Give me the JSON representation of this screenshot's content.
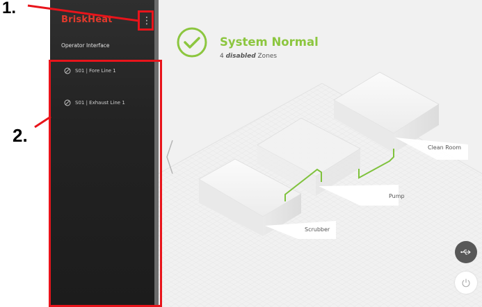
{
  "annotations": {
    "label_1": "1.",
    "label_2": "2."
  },
  "sidebar": {
    "brand": "BriskHeat",
    "subtitle": "Operator Interface",
    "zones": [
      {
        "label": "S01 | Fore Line 1",
        "icon": "disabled-icon"
      },
      {
        "label": "S01 | Exhaust Line 1",
        "icon": "disabled-icon"
      }
    ]
  },
  "status": {
    "title": "System Normal",
    "count": "4",
    "word": "disabled",
    "suffix": "Zones",
    "color": "#8cc63f"
  },
  "diagram": {
    "clean_room": "Clean Room",
    "pump": "Pump",
    "scrubber": "Scrubber"
  },
  "colors": {
    "brand": "#e33a2c",
    "accent": "#8cc63f",
    "annotation": "#e8141b"
  }
}
